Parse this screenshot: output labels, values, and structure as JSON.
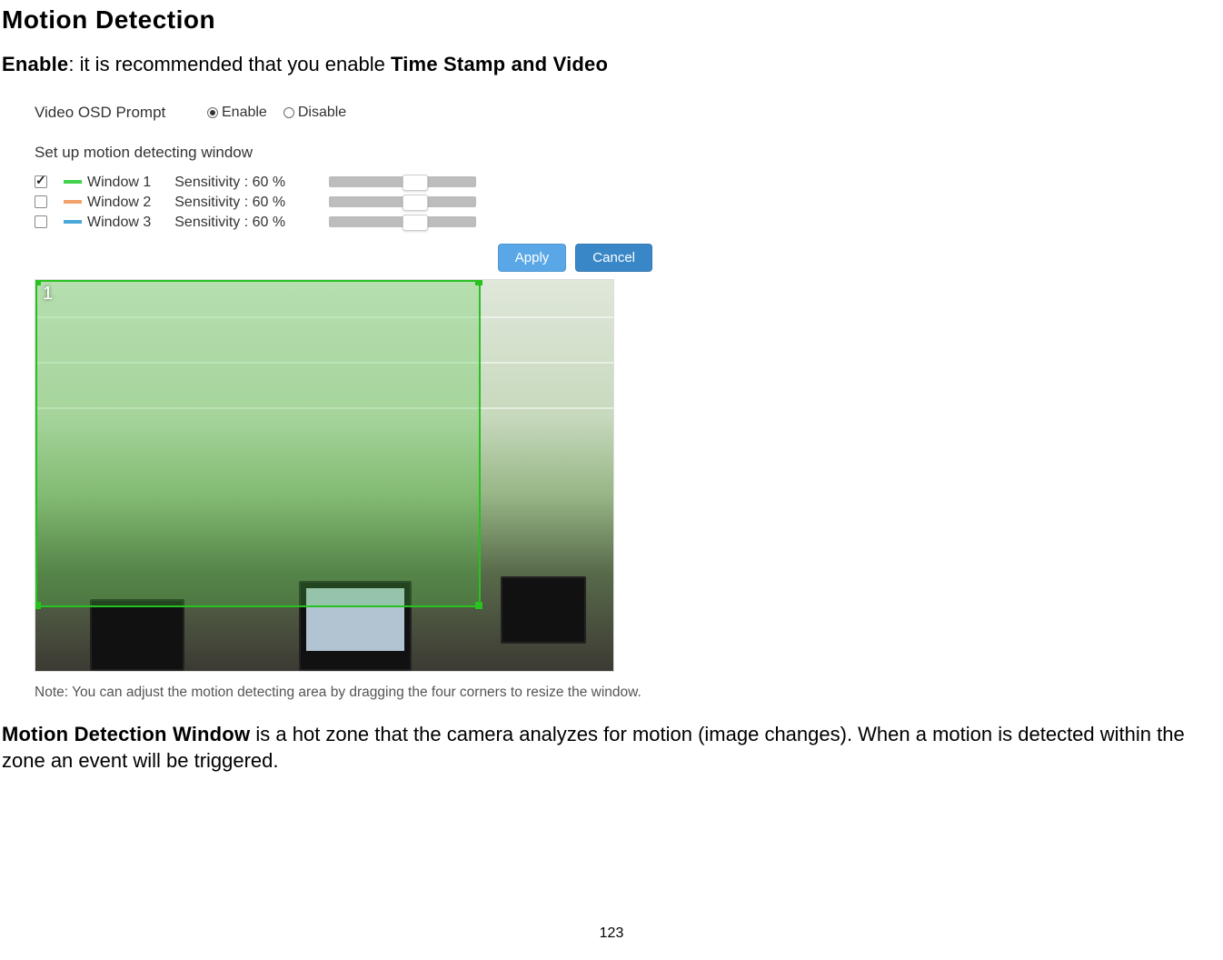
{
  "heading": "Motion Detection",
  "intro": {
    "lead_bold": "Enable",
    "text": ": it is recommended that you enable ",
    "trail_bold": "Time Stamp and Video"
  },
  "screenshot": {
    "osd_label": "Video OSD Prompt",
    "enable_label": "Enable",
    "disable_label": "Disable",
    "osd_value": "Enable",
    "setup_label": "Set up motion detecting window",
    "windows": [
      {
        "checked": true,
        "color": "#3fd24a",
        "name": "Window 1",
        "sensitivity_label": "Sensitivity : 60 %",
        "sensitivity_value": 60
      },
      {
        "checked": false,
        "color": "#f2a16a",
        "name": "Window 2",
        "sensitivity_label": "Sensitivity : 60 %",
        "sensitivity_value": 60
      },
      {
        "checked": false,
        "color": "#4aa8d8",
        "name": "Window 3",
        "sensitivity_label": "Sensitivity : 60 %",
        "sensitivity_value": 60
      }
    ],
    "apply_label": "Apply",
    "cancel_label": "Cancel",
    "preview_window_number": "1",
    "note": "Note: You can adjust the motion detecting area by dragging the four corners to resize the window."
  },
  "explain": {
    "lead_bold": "Motion Detection Window",
    "text": " is a hot zone that the camera analyzes for motion (image changes). When a motion is detected within the zone an event will be triggered."
  },
  "page_number": "123"
}
